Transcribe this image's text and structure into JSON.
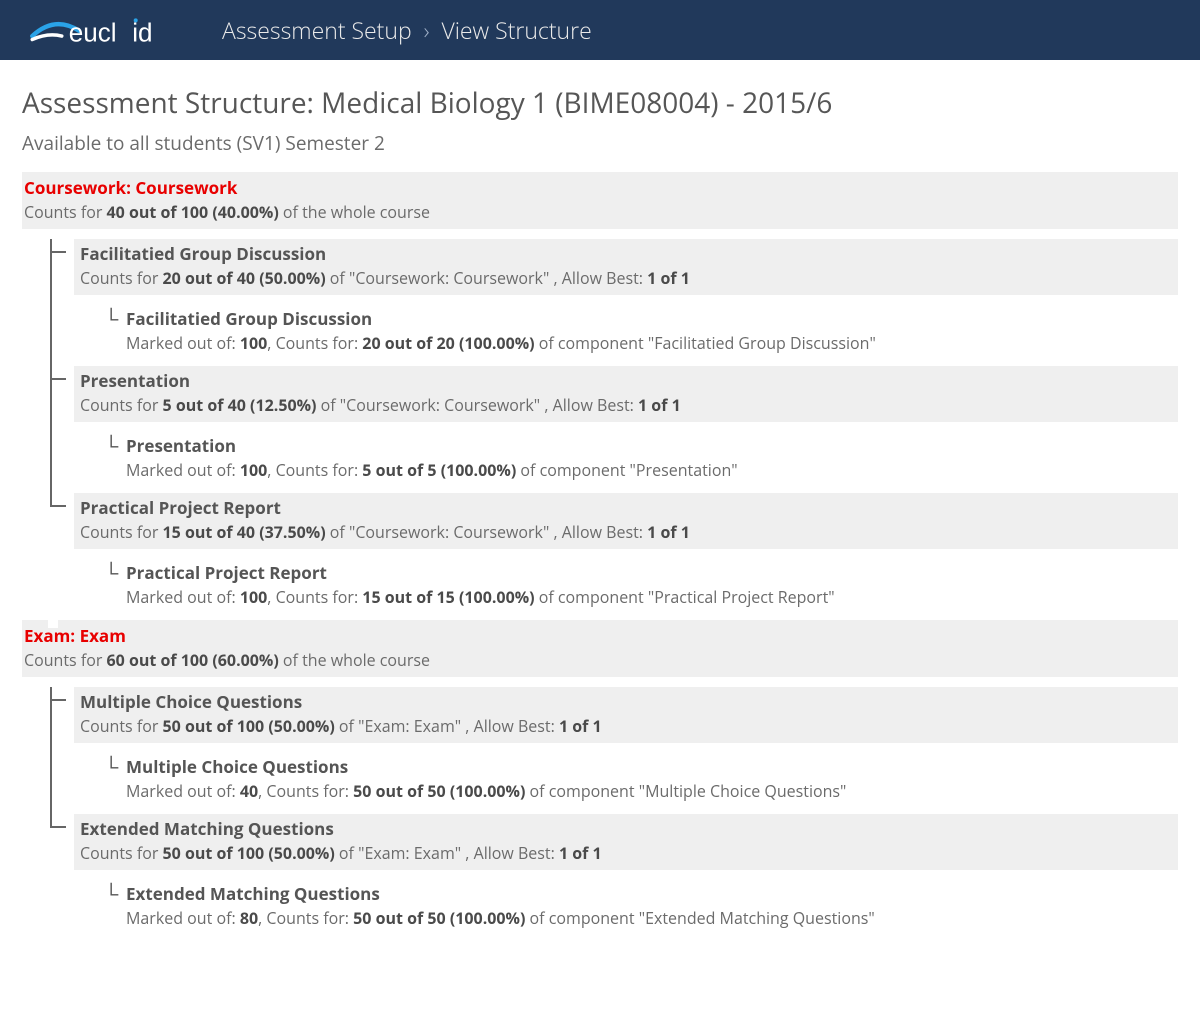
{
  "header": {
    "brand": "euclid",
    "breadcrumb1": "Assessment Setup",
    "breadcrumb2": "View Structure"
  },
  "page": {
    "title": "Assessment Structure: Medical Biology 1 (BIME08004) - 2015/6",
    "subtitle": "Available to all students (SV1) Semester 2"
  },
  "sections": [
    {
      "title": "Coursework: Coursework",
      "counts_a": "Counts for ",
      "counts_b": "40 out of 100 (40.00%)",
      "counts_c": " of the whole course",
      "components": [
        {
          "title": "Facilitatied Group Discussion",
          "sub_a": "Counts for ",
          "sub_b": "20 out of 40 (50.00%)",
          "sub_c": " of \"Coursework: Coursework\" , Allow Best: ",
          "sub_d": "1 of 1",
          "item": {
            "title": "Facilitatied Group Discussion",
            "s1": "Marked out of: ",
            "s2": "100",
            "s3": ", Counts for: ",
            "s4": "20 out of 20 (100.00%)",
            "s5": " of component \"Facilitatied Group Discussion\""
          }
        },
        {
          "title": "Presentation",
          "sub_a": "Counts for ",
          "sub_b": "5 out of 40 (12.50%)",
          "sub_c": " of \"Coursework: Coursework\" , Allow Best: ",
          "sub_d": "1 of 1",
          "item": {
            "title": "Presentation",
            "s1": "Marked out of: ",
            "s2": "100",
            "s3": ", Counts for: ",
            "s4": "5 out of 5 (100.00%)",
            "s5": " of component \"Presentation\""
          }
        },
        {
          "title": "Practical Project Report",
          "sub_a": "Counts for ",
          "sub_b": "15 out of 40 (37.50%)",
          "sub_c": " of \"Coursework: Coursework\" , Allow Best: ",
          "sub_d": "1 of 1",
          "item": {
            "title": "Practical Project Report",
            "s1": "Marked out of: ",
            "s2": "100",
            "s3": ", Counts for: ",
            "s4": "15 out of 15 (100.00%)",
            "s5": " of component \"Practical Project Report\""
          }
        }
      ]
    },
    {
      "title": "Exam: Exam",
      "counts_a": "Counts for ",
      "counts_b": "60 out of 100 (60.00%)",
      "counts_c": " of the whole course",
      "components": [
        {
          "title": "Multiple Choice Questions",
          "sub_a": "Counts for ",
          "sub_b": "50 out of 100 (50.00%)",
          "sub_c": " of \"Exam: Exam\" , Allow Best: ",
          "sub_d": "1 of 1",
          "item": {
            "title": "Multiple Choice Questions",
            "s1": "Marked out of: ",
            "s2": "40",
            "s3": ", Counts for: ",
            "s4": "50 out of 50 (100.00%)",
            "s5": " of component \"Multiple Choice Questions\""
          }
        },
        {
          "title": "Extended Matching Questions",
          "sub_a": "Counts for ",
          "sub_b": "50 out of 100 (50.00%)",
          "sub_c": " of \"Exam: Exam\" , Allow Best: ",
          "sub_d": "1 of 1",
          "item": {
            "title": "Extended Matching Questions",
            "s1": "Marked out of: ",
            "s2": "80",
            "s3": ", Counts for: ",
            "s4": "50 out of 50 (100.00%)",
            "s5": " of component \"Extended Matching Questions\""
          }
        }
      ]
    }
  ]
}
